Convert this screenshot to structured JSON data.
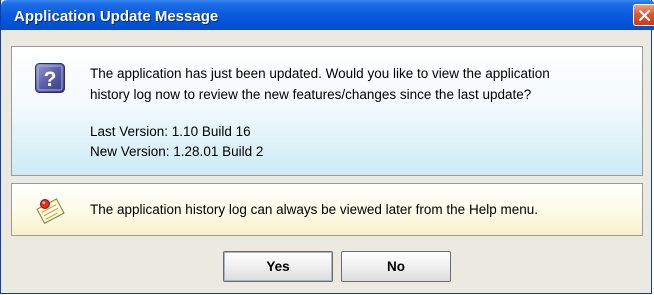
{
  "window": {
    "title": "Application Update Message"
  },
  "question_panel": {
    "icon": "question-icon",
    "line1": "The application has just been updated. Would you like to view the application",
    "line2": "history log now to review the new features/changes since the last update?",
    "last_version": "Last Version: 1.10 Build 16",
    "new_version": "New Version: 1.28.01 Build 2"
  },
  "note_panel": {
    "icon": "notepad-pushpin-icon",
    "text": "The application history log can always be viewed later from the Help menu."
  },
  "buttons": {
    "yes_label": "Yes",
    "no_label": "No"
  },
  "colors": {
    "titlebar": "#0a5bdd",
    "close_button": "#e2572f",
    "question_icon": "#5a5fa8"
  }
}
